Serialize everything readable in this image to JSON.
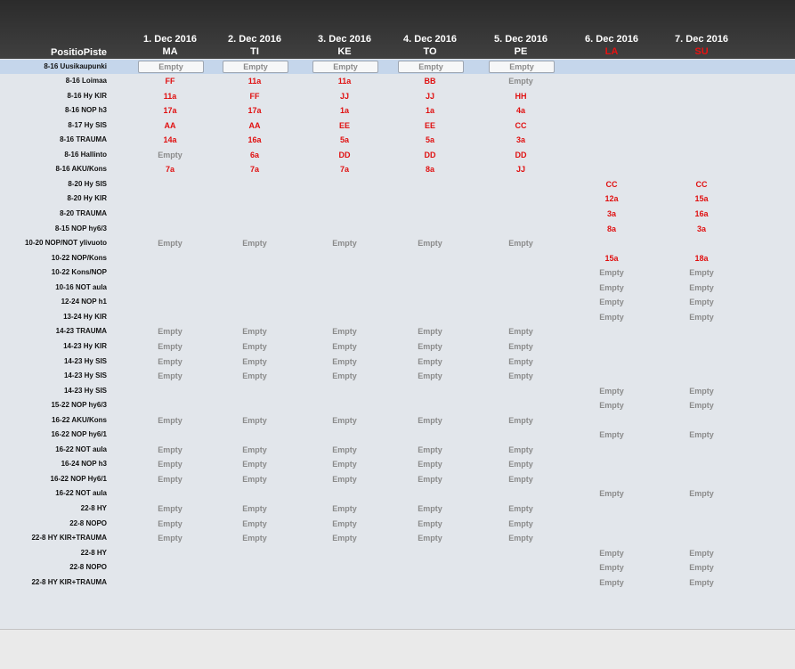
{
  "header": {
    "title": "PositioPiste",
    "columns": [
      {
        "date": "1. Dec 2016",
        "day": "MA",
        "weekend": false
      },
      {
        "date": "2. Dec 2016",
        "day": "TI",
        "weekend": false
      },
      {
        "date": "3. Dec 2016",
        "day": "KE",
        "weekend": false
      },
      {
        "date": "4. Dec 2016",
        "day": "TO",
        "weekend": false
      },
      {
        "date": "5. Dec 2016",
        "day": "PE",
        "weekend": false
      },
      {
        "date": "6. Dec 2016",
        "day": "LA",
        "weekend": true
      },
      {
        "date": "7. Dec 2016",
        "day": "SU",
        "weekend": true
      }
    ]
  },
  "colors": {
    "accent": "#e01010",
    "selected_row": "#c5d6eb",
    "empty_text": "#8a8a8a"
  },
  "rows": [
    {
      "label": "8-16 Uusikaupunki",
      "selected": true,
      "cells": [
        "Empty",
        "Empty",
        "Empty",
        "Empty",
        "Empty",
        "",
        ""
      ]
    },
    {
      "label": "8-16 Loimaa",
      "cells": [
        "FF",
        "11a",
        "11a",
        "BB",
        "Empty",
        "",
        ""
      ]
    },
    {
      "label": "8-16 Hy KIR",
      "cells": [
        "11a",
        "FF",
        "JJ",
        "JJ",
        "HH",
        "",
        ""
      ]
    },
    {
      "label": "8-16 NOP h3",
      "cells": [
        "17a",
        "17a",
        "1a",
        "1a",
        "4a",
        "",
        ""
      ]
    },
    {
      "label": "8-17 Hy SIS",
      "cells": [
        "AA",
        "AA",
        "EE",
        "EE",
        "CC",
        "",
        ""
      ]
    },
    {
      "label": "8-16 TRAUMA",
      "cells": [
        "14a",
        "16a",
        "5a",
        "5a",
        "3a",
        "",
        ""
      ]
    },
    {
      "label": "8-16 Hallinto",
      "cells": [
        "Empty",
        "6a",
        "DD",
        "DD",
        "DD",
        "",
        ""
      ]
    },
    {
      "label": "8-16 AKU/Kons",
      "cells": [
        "7a",
        "7a",
        "7a",
        "8a",
        "JJ",
        "",
        ""
      ]
    },
    {
      "label": "8-20 Hy SIS",
      "cells": [
        "",
        "",
        "",
        "",
        "",
        "CC",
        "CC"
      ]
    },
    {
      "label": "8-20 Hy KIR",
      "cells": [
        "",
        "",
        "",
        "",
        "",
        "12a",
        "15a"
      ]
    },
    {
      "label": "8-20 TRAUMA",
      "cells": [
        "",
        "",
        "",
        "",
        "",
        "3a",
        "16a"
      ]
    },
    {
      "label": "8-15 NOP hy6/3",
      "cells": [
        "",
        "",
        "",
        "",
        "",
        "8a",
        "3a"
      ]
    },
    {
      "label": "10-20 NOP/NOT ylivuoto",
      "cells": [
        "Empty",
        "Empty",
        "Empty",
        "Empty",
        "Empty",
        "",
        ""
      ]
    },
    {
      "label": "10-22 NOP/Kons",
      "cells": [
        "",
        "",
        "",
        "",
        "",
        "15a",
        "18a"
      ]
    },
    {
      "label": "10-22 Kons/NOP",
      "cells": [
        "",
        "",
        "",
        "",
        "",
        "Empty",
        "Empty"
      ]
    },
    {
      "label": "10-16 NOT aula",
      "cells": [
        "",
        "",
        "",
        "",
        "",
        "Empty",
        "Empty"
      ]
    },
    {
      "label": "12-24 NOP h1",
      "cells": [
        "",
        "",
        "",
        "",
        "",
        "Empty",
        "Empty"
      ]
    },
    {
      "label": "13-24 Hy KIR",
      "cells": [
        "",
        "",
        "",
        "",
        "",
        "Empty",
        "Empty"
      ]
    },
    {
      "label": "14-23 TRAUMA",
      "cells": [
        "Empty",
        "Empty",
        "Empty",
        "Empty",
        "Empty",
        "",
        ""
      ]
    },
    {
      "label": "14-23 Hy KIR",
      "cells": [
        "Empty",
        "Empty",
        "Empty",
        "Empty",
        "Empty",
        "",
        ""
      ]
    },
    {
      "label": "14-23 Hy SIS",
      "cells": [
        "Empty",
        "Empty",
        "Empty",
        "Empty",
        "Empty",
        "",
        ""
      ]
    },
    {
      "label": "14-23 Hy SIS",
      "cells": [
        "Empty",
        "Empty",
        "Empty",
        "Empty",
        "Empty",
        "",
        ""
      ]
    },
    {
      "label": "14-23 Hy SIS",
      "cells": [
        "",
        "",
        "",
        "",
        "",
        "Empty",
        "Empty"
      ]
    },
    {
      "label": "15-22 NOP hy6/3",
      "cells": [
        "",
        "",
        "",
        "",
        "",
        "Empty",
        "Empty"
      ]
    },
    {
      "label": "16-22 AKU/Kons",
      "cells": [
        "Empty",
        "Empty",
        "Empty",
        "Empty",
        "Empty",
        "",
        ""
      ]
    },
    {
      "label": "16-22 NOP hy6/1",
      "cells": [
        "",
        "",
        "",
        "",
        "",
        "Empty",
        "Empty"
      ]
    },
    {
      "label": "16-22 NOT aula",
      "cells": [
        "Empty",
        "Empty",
        "Empty",
        "Empty",
        "Empty",
        "",
        ""
      ]
    },
    {
      "label": "16-24 NOP h3",
      "cells": [
        "Empty",
        "Empty",
        "Empty",
        "Empty",
        "Empty",
        "",
        ""
      ]
    },
    {
      "label": "16-22 NOP Hy6/1",
      "cells": [
        "Empty",
        "Empty",
        "Empty",
        "Empty",
        "Empty",
        "",
        ""
      ]
    },
    {
      "label": "16-22 NOT aula",
      "cells": [
        "",
        "",
        "",
        "",
        "",
        "Empty",
        "Empty"
      ]
    },
    {
      "label": "22-8 HY",
      "cells": [
        "Empty",
        "Empty",
        "Empty",
        "Empty",
        "Empty",
        "",
        ""
      ]
    },
    {
      "label": "22-8 NOPO",
      "cells": [
        "Empty",
        "Empty",
        "Empty",
        "Empty",
        "Empty",
        "",
        ""
      ]
    },
    {
      "label": "22-8 HY KIR+TRAUMA",
      "cells": [
        "Empty",
        "Empty",
        "Empty",
        "Empty",
        "Empty",
        "",
        ""
      ]
    },
    {
      "label": "22-8 HY",
      "cells": [
        "",
        "",
        "",
        "",
        "",
        "Empty",
        "Empty"
      ]
    },
    {
      "label": "22-8 NOPO",
      "cells": [
        "",
        "",
        "",
        "",
        "",
        "Empty",
        "Empty"
      ]
    },
    {
      "label": "22-8 HY KIR+TRAUMA",
      "cells": [
        "",
        "",
        "",
        "",
        "",
        "Empty",
        "Empty"
      ]
    }
  ]
}
